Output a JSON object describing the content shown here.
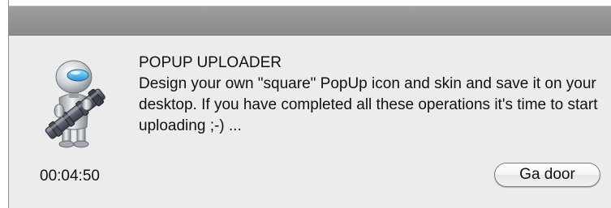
{
  "dialog": {
    "title": "POPUP UPLOADER",
    "message": "Design your own \"square\" PopUp icon and skin and save it on your desktop. If you have completed all these operations it's time to start uploading ;-) ...",
    "timer": "00:04:50",
    "button_label": "Ga door",
    "icon": "automator-robot-icon"
  }
}
